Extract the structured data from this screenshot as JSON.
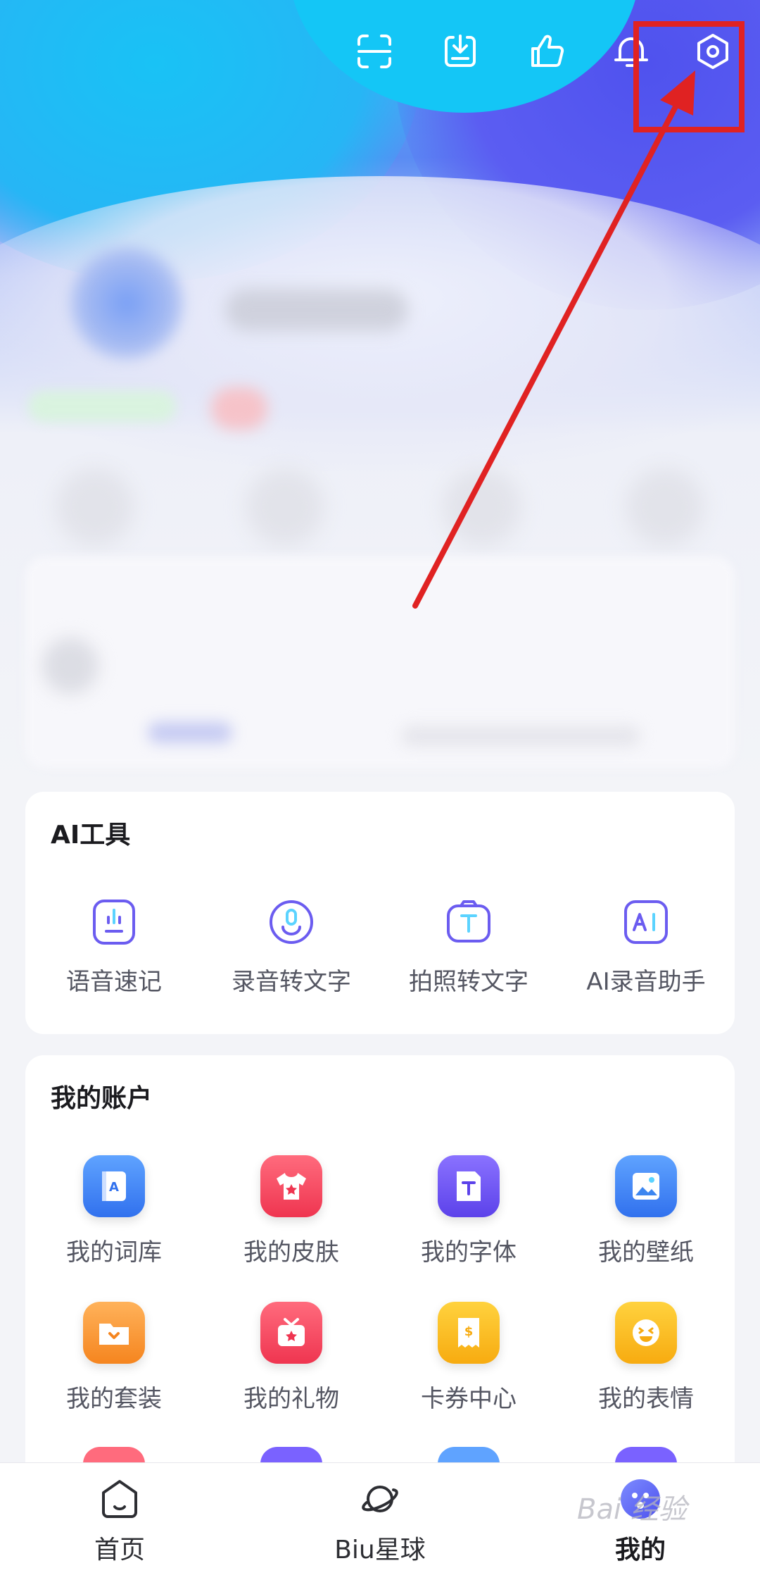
{
  "ai_tools": {
    "title": "AI工具",
    "items": [
      {
        "label": "语音速记",
        "icon": "mic-note-icon"
      },
      {
        "label": "录音转文字",
        "icon": "recording-to-text-icon"
      },
      {
        "label": "拍照转文字",
        "icon": "photo-to-text-icon"
      },
      {
        "label": "AI录音助手",
        "icon": "ai-recording-assistant-icon"
      }
    ]
  },
  "account": {
    "title": "我的账户",
    "items": [
      {
        "label": "我的词库",
        "icon": "lexicon-book-icon",
        "color": "#3d86f0"
      },
      {
        "label": "我的皮肤",
        "icon": "tshirt-skin-icon",
        "color": "#f0455b"
      },
      {
        "label": "我的字体",
        "icon": "font-file-icon",
        "color": "#6b4ff0"
      },
      {
        "label": "我的壁纸",
        "icon": "wallpaper-image-icon",
        "color": "#3d86f0"
      },
      {
        "label": "我的套装",
        "icon": "suit-folder-icon",
        "color": "#f59428"
      },
      {
        "label": "我的礼物",
        "icon": "gift-box-icon",
        "color": "#f0455b"
      },
      {
        "label": "卡券中心",
        "icon": "coupon-ticket-icon",
        "color": "#f7b21c"
      },
      {
        "label": "我的表情",
        "icon": "emoji-face-icon",
        "color": "#f7b21c"
      }
    ]
  },
  "bottom_nav": {
    "items": [
      {
        "label": "首页",
        "icon": "home-icon"
      },
      {
        "label": "Biu星球",
        "icon": "planet-icon"
      },
      {
        "label": "我的",
        "icon": "profile-avatar-icon"
      }
    ]
  },
  "colors": {
    "annotation": "#e02222",
    "accent_purple": "#6b5cf0",
    "header_blue": "#19c2f5"
  },
  "watermark": "Bai 经验"
}
